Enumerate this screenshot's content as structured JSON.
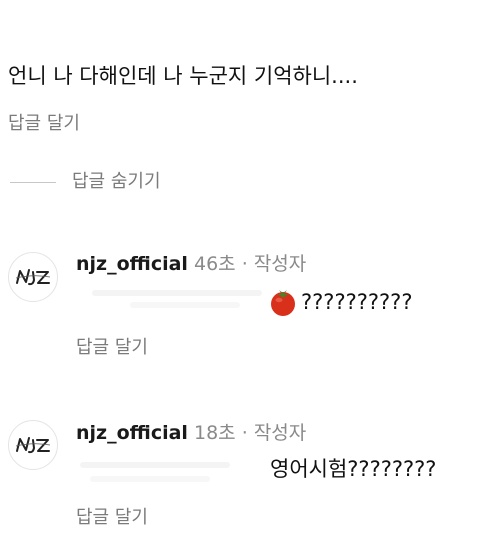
{
  "parent_comment": {
    "text": "언니 나 다해인데 나 누군지 기억하니....",
    "reply_label": "답글 달기"
  },
  "thread": {
    "hide_replies_label": "답글 숨기기"
  },
  "replies": [
    {
      "username": "njz_official",
      "time": "46초",
      "separator": "·",
      "author_badge": "작성자",
      "text": "??????????",
      "has_tomato": true,
      "reply_label": "답글 달기",
      "avatar_text": "NJZ"
    },
    {
      "username": "njz_official",
      "time": "18초",
      "separator": "·",
      "author_badge": "작성자",
      "text": "영어시험????????",
      "has_tomato": false,
      "reply_label": "답글 달기",
      "avatar_text": "NJZ"
    }
  ],
  "colors": {
    "text": "#111111",
    "secondary": "#7b7b7b",
    "divider": "#c7c7c7",
    "tomato": "#d9301c"
  },
  "icons": {
    "tomato": "tomato-emoji-icon",
    "avatar": "njz-logo-icon"
  }
}
